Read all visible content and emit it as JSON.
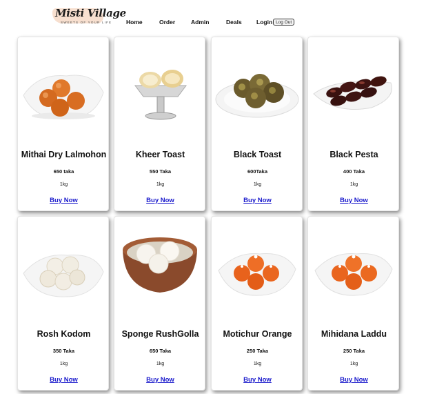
{
  "brand": {
    "name": "Misti Village",
    "tagline": "SWEETS OF YOUR LIFE"
  },
  "nav": {
    "home": "Home",
    "order": "Order",
    "admin": "Admin",
    "deals": "Deals",
    "login": "Login",
    "logout": "Log Out"
  },
  "products": [
    {
      "name": "Mithai Dry Lalmohon",
      "price": "650 taka",
      "weight": "1kg",
      "buy": "Buy Now",
      "image": "lalmohon-plate"
    },
    {
      "name": "Kheer Toast",
      "price": "550 Taka",
      "weight": "1kg",
      "buy": "Buy Now",
      "image": "kheer-toast-stand"
    },
    {
      "name": "Black Toast",
      "price": "600Taka",
      "weight": "1kg",
      "buy": "Buy Now",
      "image": "black-toast-plate"
    },
    {
      "name": "Black Pesta",
      "price": "400 Taka",
      "weight": "1kg",
      "buy": "Buy Now",
      "image": "black-pesta-plate"
    },
    {
      "name": "Rosh Kodom",
      "price": "350 Taka",
      "weight": "1kg",
      "buy": "Buy Now",
      "image": "rosh-kodom-plate"
    },
    {
      "name": "Sponge RushGolla",
      "price": "650 Taka",
      "weight": "1kg",
      "buy": "Buy Now",
      "image": "rushgolla-bowl"
    },
    {
      "name": "Motichur Orange",
      "price": "250 Taka",
      "weight": "1kg",
      "buy": "Buy Now",
      "image": "motichur-plate"
    },
    {
      "name": "Mihidana Laddu",
      "price": "250 Taka",
      "weight": "1kg",
      "buy": "Buy Now",
      "image": "laddu-plate"
    }
  ]
}
